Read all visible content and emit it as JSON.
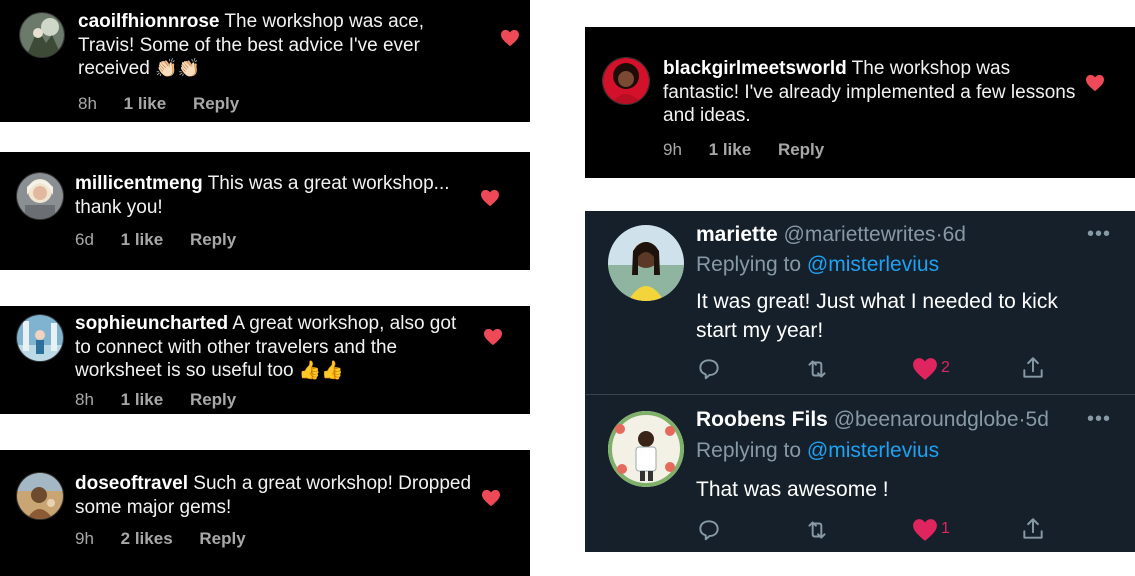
{
  "instagram_comments": [
    {
      "username": "caoilfhionnrose",
      "text": "The workshop was ace, Travis! Some of the best advice I've ever received",
      "emoji": "👏🏻👏🏻",
      "time": "8h",
      "likes": "1 like",
      "reply": "Reply"
    },
    {
      "username": "millicentmeng",
      "text": "This was a great workshop... thank you!",
      "emoji": "",
      "time": "6d",
      "likes": "1 like",
      "reply": "Reply"
    },
    {
      "username": "sophieuncharted",
      "text": "A great workshop, also got to connect with other travelers and the worksheet is so useful too",
      "emoji": "👍👍",
      "time": "8h",
      "likes": "1 like",
      "reply": "Reply"
    },
    {
      "username": "doseoftravel",
      "text": "Such a great workshop! Dropped some major gems!",
      "emoji": "",
      "time": "9h",
      "likes": "2 likes",
      "reply": "Reply"
    },
    {
      "username": "blackgirlmeetsworld",
      "text": "The workshop was fantastic! I've already implemented a few lessons and ideas.",
      "emoji": "",
      "time": "9h",
      "likes": "1 like",
      "reply": "Reply"
    }
  ],
  "tweets": [
    {
      "name": "mariette",
      "handle": "@mariettewrites",
      "dot": "·",
      "time": "6d",
      "replying_prefix": "Replying to",
      "mention": "@misterlevius",
      "body_line1": "It was great! Just what I needed to kick",
      "body_line2": "start my year!",
      "like_count": "2"
    },
    {
      "name": "Roobens Fils",
      "handle": "@beenaroundglobe",
      "dot": "·",
      "time": "5d",
      "replying_prefix": "Replying to",
      "mention": "@misterlevius",
      "body_line1": "That was awesome !",
      "body_line2": "",
      "like_count": "1"
    }
  ],
  "icons": {
    "heart": "heart-icon",
    "reply": "reply-icon",
    "retweet": "retweet-icon",
    "share": "share-icon",
    "more": "more-icon"
  },
  "colors": {
    "heart": "#ed4956",
    "twitter_like": "#e0245e",
    "twitter_bg": "#15202b",
    "twitter_link": "#1da1f2",
    "instagram_bg": "#000000"
  }
}
